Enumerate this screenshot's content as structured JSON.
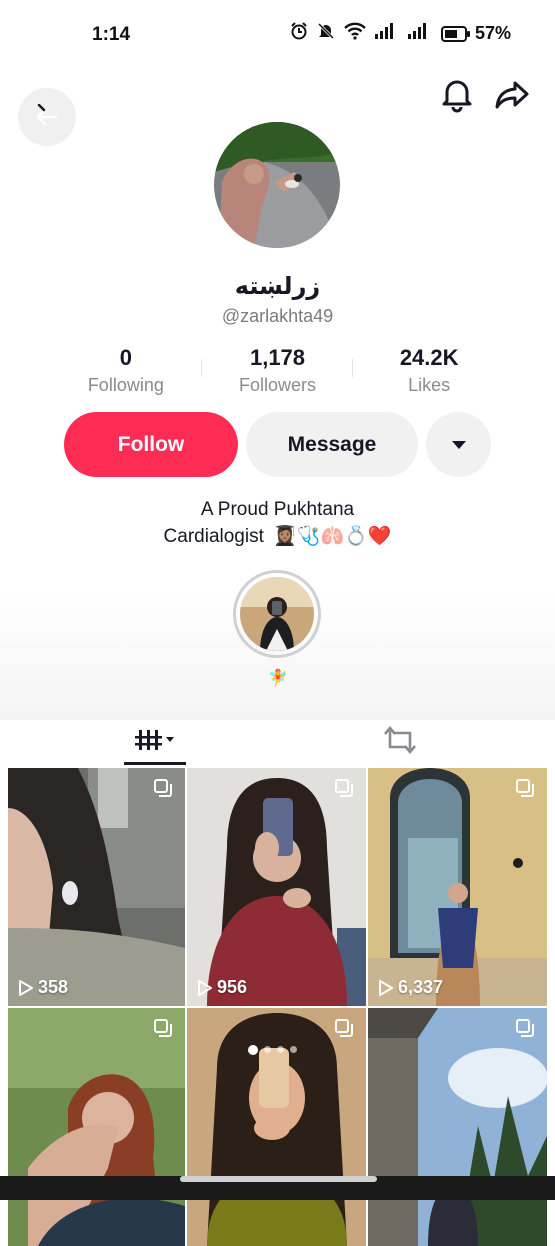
{
  "status_bar": {
    "time": "1:14",
    "battery": "57%"
  },
  "profile": {
    "display_name": "زرلښته",
    "username": "@zarlakhta49",
    "stats": [
      {
        "value": "0",
        "label": "Following"
      },
      {
        "value": "1,178",
        "label": "Followers"
      },
      {
        "value": "24.2K",
        "label": "Likes"
      }
    ],
    "follow_label": "Follow",
    "message_label": "Message",
    "bio_line1": "A Proud Pukhtana",
    "bio_line2": "Cardialogist",
    "bio_emojis": "👩🏽‍🎓🩺🫁💍❤️",
    "highlight_label": "🧚"
  },
  "videos": [
    {
      "views": "358"
    },
    {
      "views": "956"
    },
    {
      "views": "6,337"
    },
    {
      "views": ""
    },
    {
      "views": ""
    },
    {
      "views": ""
    }
  ],
  "icons": {
    "back": "back-arrow-icon",
    "bell": "bell-icon",
    "share": "share-icon",
    "dropdown": "caret-down-icon",
    "videos_tab": "grid-icon",
    "repost_tab": "repost-icon",
    "play": "play-icon",
    "multi": "multi-photo-icon"
  },
  "colors": {
    "accent": "#fe2c55",
    "secondary_button": "#f1f1f2"
  }
}
